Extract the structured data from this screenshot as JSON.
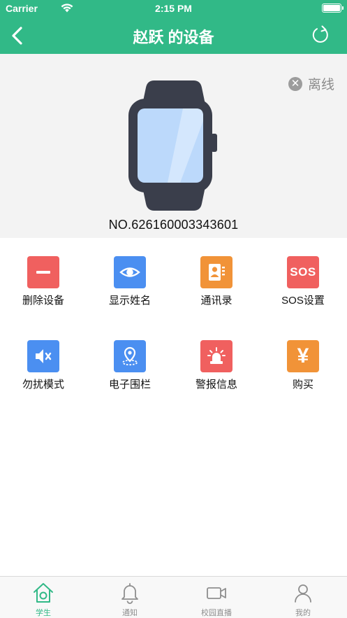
{
  "status_bar": {
    "carrier": "Carrier",
    "time": "2:15 PM"
  },
  "nav": {
    "title": "赵跃 的设备"
  },
  "device": {
    "status": "离线",
    "number": "NO.626160003343601"
  },
  "menu": [
    {
      "label": "删除设备",
      "color": "#f0605f",
      "icon": "minus-icon"
    },
    {
      "label": "显示姓名",
      "color": "#4b8ff1",
      "icon": "eye-icon"
    },
    {
      "label": "通讯录",
      "color": "#f19338",
      "icon": "contacts-icon"
    },
    {
      "label": "SOS设置",
      "color": "#f0605f",
      "icon": "sos-icon"
    },
    {
      "label": "勿扰模式",
      "color": "#4b8ff1",
      "icon": "mute-icon"
    },
    {
      "label": "电子围栏",
      "color": "#4b8ff1",
      "icon": "geofence-icon"
    },
    {
      "label": "警报信息",
      "color": "#f0605f",
      "icon": "alarm-icon"
    },
    {
      "label": "购买",
      "color": "#f19338",
      "icon": "yen-icon"
    }
  ],
  "sos_text": "SOS",
  "yen_text": "¥",
  "tabs": [
    {
      "label": "学生",
      "active": true,
      "icon": "home-icon"
    },
    {
      "label": "通知",
      "active": false,
      "icon": "bell-icon"
    },
    {
      "label": "校园直播",
      "active": false,
      "icon": "video-icon"
    },
    {
      "label": "我的",
      "active": false,
      "icon": "user-icon"
    }
  ],
  "accent_color": "#31b987"
}
